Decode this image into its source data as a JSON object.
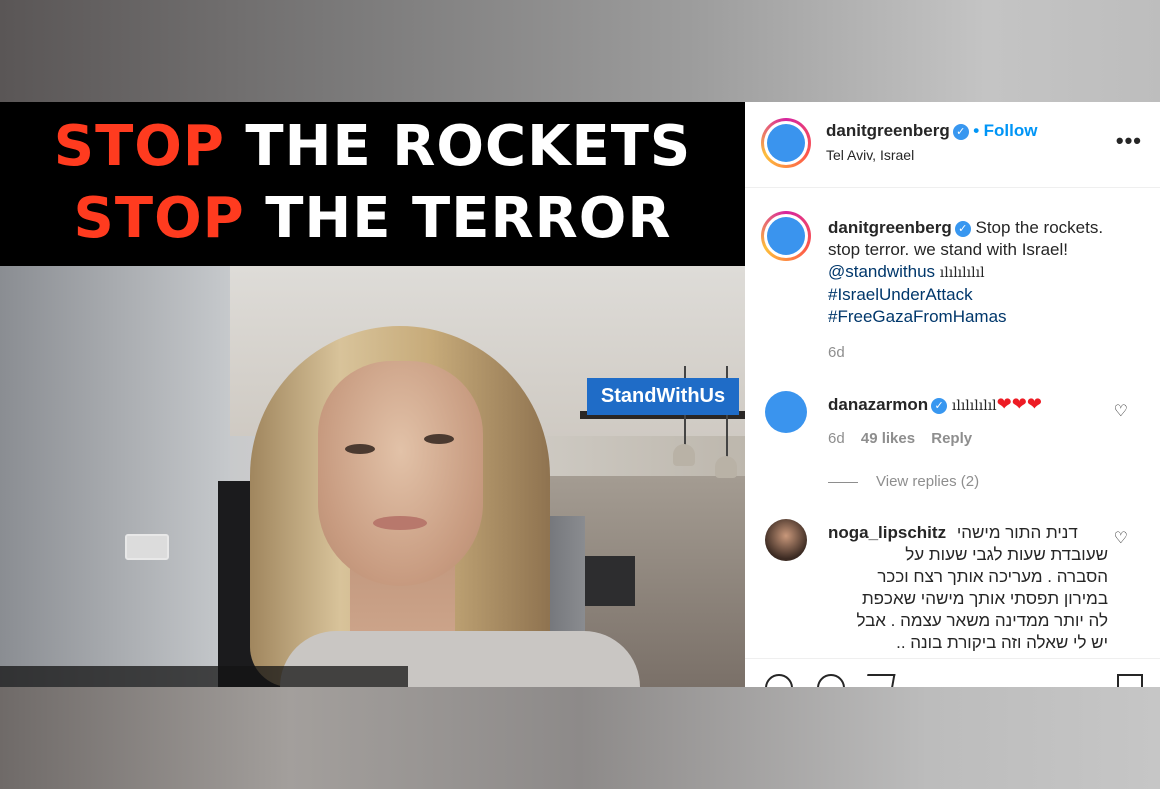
{
  "media": {
    "headline_line1_word1": "STOP",
    "headline_line1_rest": "THE ROCKETS",
    "headline_line2_word1": "STOP",
    "headline_line2_rest": "THE TERROR",
    "badge": "StandWithUs",
    "headline_red": "#ff3b1f",
    "badge_color": "#1f6cc7"
  },
  "post_header": {
    "username": "danitgreenberg",
    "follow_separator": "•",
    "follow_label": "Follow",
    "location": "Tel Aviv, Israel",
    "more_icon": "more-icon"
  },
  "caption": {
    "username": "danitgreenberg",
    "text_line1": "Stop the rockets.",
    "text_line2": "stop terror. we stand with Israel!",
    "mention": "@standwithus",
    "mention_suffix": "ılılılılıl",
    "hashtag1": "#IsraelUnderAttack",
    "hashtag2": "#FreeGazaFromHamas",
    "time": "6d"
  },
  "comments": [
    {
      "username": "danazarmon",
      "text": "ılılılılıl",
      "hearts": "❤❤❤",
      "time": "6d",
      "likes": "49 likes",
      "reply": "Reply",
      "view_replies": "View replies (2)"
    },
    {
      "username": "noga_lipschitz",
      "line1": "דנית התור מישהי",
      "line2": "שעובדת שעות לגבי שעות על",
      "line3": "הסברה . מעריכה אותך רצח וככר",
      "line4": "במירון תפסתי אותך מישהי שאכפת",
      "line5": "לה יותר ממדינה משאר עצמה . אבל",
      "line6": "יש לי שאלה וזה ביקורת בונה .."
    }
  ],
  "actions": {
    "icons": [
      "heart-icon",
      "comment-icon",
      "share-icon",
      "bookmark-icon"
    ]
  }
}
